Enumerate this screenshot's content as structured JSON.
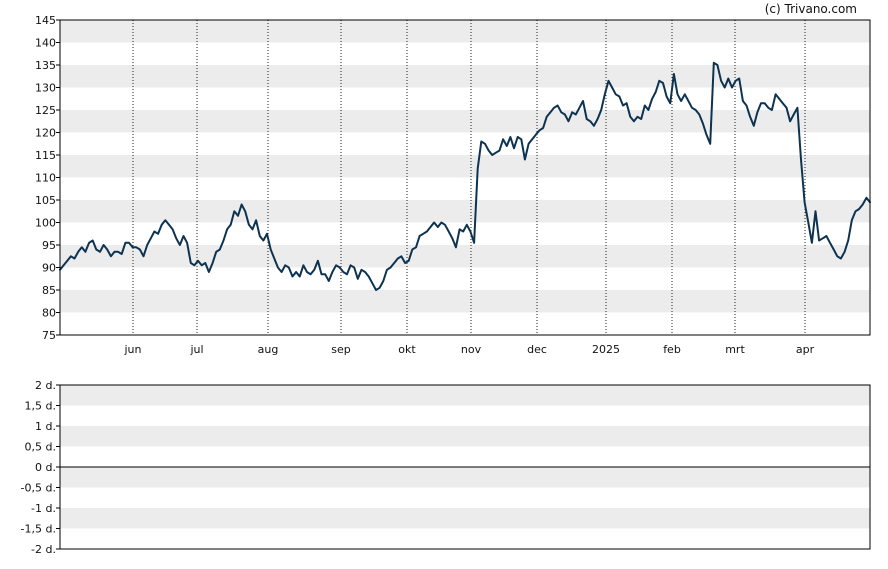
{
  "credit": "(c) Trivano.com",
  "colors": {
    "line": "#0d3350",
    "band": "#ececec",
    "grid": "#222222",
    "frame": "#000000"
  },
  "chart_data": [
    {
      "type": "line",
      "title": "",
      "xlabel": "",
      "ylabel": "",
      "ylim": [
        75,
        145
      ],
      "yticks": [
        75,
        80,
        85,
        90,
        95,
        100,
        105,
        110,
        115,
        120,
        125,
        130,
        135,
        140,
        145
      ],
      "month_labels": [
        "jun",
        "jul",
        "aug",
        "sep",
        "okt",
        "nov",
        "dec",
        "2025",
        "feb",
        "mrt",
        "apr"
      ],
      "grid": "horizontal bands, dotted vertical month lines",
      "legend": "none",
      "series": [
        {
          "values": [
            89.5,
            90.5,
            91.5,
            92.5,
            92,
            93.5,
            94.5,
            93.5,
            95.5,
            96,
            94,
            93.5,
            95,
            94,
            92.5,
            93.5,
            93.5,
            93,
            95.5,
            95.5,
            94.5,
            94.5,
            94,
            92.5,
            95,
            96.5,
            98,
            97.5,
            99.5,
            100.5,
            99.5,
            98.5,
            96.5,
            95,
            97,
            95.5,
            91,
            90.5,
            91.5,
            90.5,
            91,
            89,
            91,
            93.5,
            94,
            96,
            98.5,
            99.5,
            102.5,
            101.5,
            104,
            102.5,
            99.5,
            98.5,
            100.5,
            97,
            96,
            97.5,
            94,
            92,
            90,
            89,
            90.5,
            90,
            88,
            89,
            88,
            90.5,
            89,
            88.5,
            89.5,
            91.5,
            88.5,
            88.5,
            87,
            89,
            90.5,
            90,
            89,
            88.5,
            90.5,
            90,
            87.5,
            89.5,
            89,
            88,
            86.5,
            85,
            85.5,
            87,
            89.5,
            90,
            91,
            92,
            92.5,
            91,
            91.5,
            94,
            94.5,
            97,
            97.5,
            98,
            99,
            100,
            99,
            100,
            99.5,
            98,
            96.5,
            94.5,
            98.5,
            98,
            99.5,
            98,
            95.5,
            112,
            118,
            117.5,
            116,
            115,
            115.5,
            116,
            118.5,
            117,
            119,
            116.5,
            119,
            118.5,
            114,
            117.5,
            118.5,
            119.5,
            120.5,
            121,
            123.5,
            124.5,
            125.5,
            126,
            124.5,
            124,
            122.5,
            124.5,
            124,
            125.5,
            127,
            123,
            122.5,
            121.5,
            123,
            125,
            128.5,
            131.5,
            130,
            128.5,
            128,
            126,
            126.5,
            123.5,
            122.5,
            123.5,
            123,
            126,
            125,
            127.5,
            129,
            131.5,
            131,
            128,
            126.5,
            133,
            128.5,
            127,
            128.5,
            127,
            125.5,
            125,
            124,
            122,
            119.5,
            117.5,
            135.5,
            135,
            131.5,
            130,
            132,
            130,
            131.5,
            132,
            127,
            126,
            123.5,
            121.5,
            124.5,
            126.5,
            126.5,
            125.5,
            125,
            128.5,
            127.5,
            126.5,
            125.5,
            122.5,
            124,
            125.5,
            114,
            104.5,
            100,
            95.5,
            102.5,
            96,
            96.5,
            97,
            95.5,
            94,
            92.5,
            92,
            93.5,
            96,
            100.5,
            102.5,
            103,
            104,
            105.5,
            104.5
          ]
        }
      ]
    },
    {
      "type": "line",
      "title": "",
      "xlabel": "",
      "ylabel": "",
      "ylim": [
        -2,
        2
      ],
      "yticks": [
        -2,
        -1.5,
        -1,
        -0.5,
        0,
        0.5,
        1,
        1.5,
        2
      ],
      "ytick_labels": [
        "-2 d.",
        "-1,5 d.",
        "-1 d.",
        "-0,5 d.",
        "0 d.",
        "0,5 d.",
        "1 d.",
        "1,5 d.",
        "2 d."
      ],
      "legend": "none",
      "series": [
        {
          "values": [
            0
          ]
        }
      ]
    }
  ]
}
